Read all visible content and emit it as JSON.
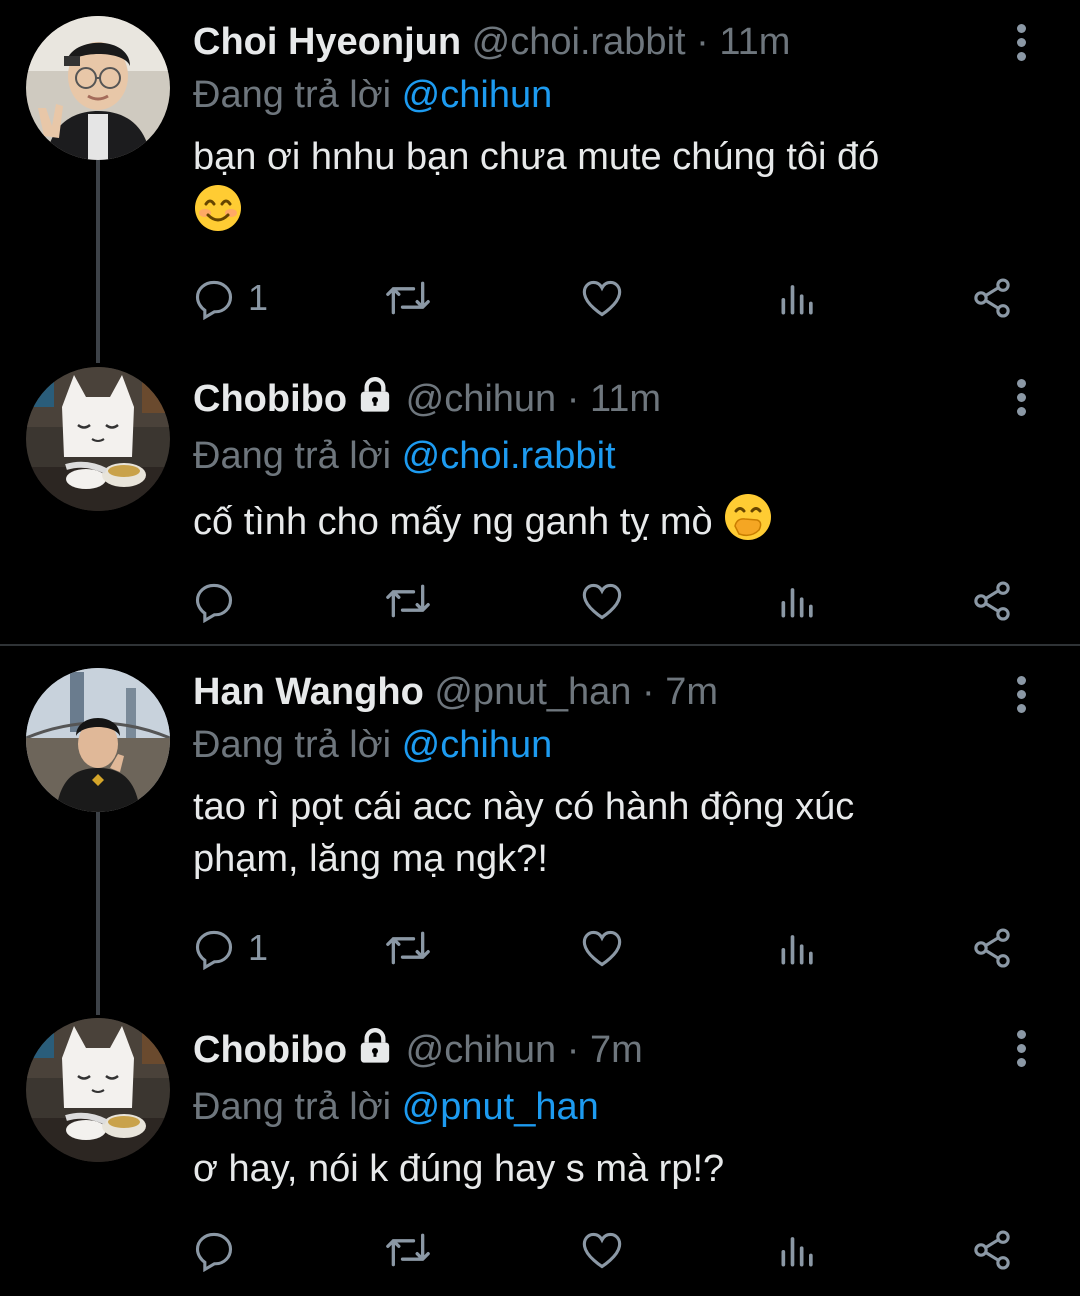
{
  "tweets": [
    {
      "name": "Choi Hyeonjun",
      "handle": "@choi.rabbit",
      "time": "· 11m",
      "reply_prefix": "Đang trả lời",
      "reply_to": "@chihun",
      "text": "bạn ơi hnhu bạn chưa mute chúng tôi đó",
      "emoji": "😊",
      "reply_count": "1",
      "locked": false
    },
    {
      "name": "Chobibo",
      "handle": "@chihun",
      "time": "· 11m",
      "reply_prefix": "Đang trả lời",
      "reply_to": "@choi.rabbit",
      "text": "cố tình cho mấy ng ganh tỵ mò",
      "emoji": "🤭",
      "reply_count": "",
      "locked": true
    },
    {
      "name": "Han Wangho",
      "handle": "@pnut_han",
      "time": "· 7m",
      "reply_prefix": "Đang trả lời",
      "reply_to": "@chihun",
      "text_line1": "tao rì pọt cái acc này có hành động xúc",
      "text_line2": "phạm, lăng mạ ngk?!",
      "reply_count": "1",
      "locked": false
    },
    {
      "name": "Chobibo",
      "handle": "@chihun",
      "time": "· 7m",
      "reply_prefix": "Đang trả lời",
      "reply_to": "@pnut_han",
      "text": "ơ hay, nói k đúng hay s mà rp!?",
      "reply_count": "",
      "locked": true
    }
  ],
  "icons": {
    "reply": "reply-icon",
    "retweet": "retweet-icon",
    "like": "heart-icon",
    "views": "bar-chart-icon",
    "share": "share-icon",
    "more": "more-vertical-icon",
    "lock": "lock-icon"
  },
  "colors": {
    "background": "#000000",
    "name": "#e7e9ea",
    "muted": "#6e767d",
    "link": "#1d9bf0",
    "thread_line": "#3d4248"
  }
}
